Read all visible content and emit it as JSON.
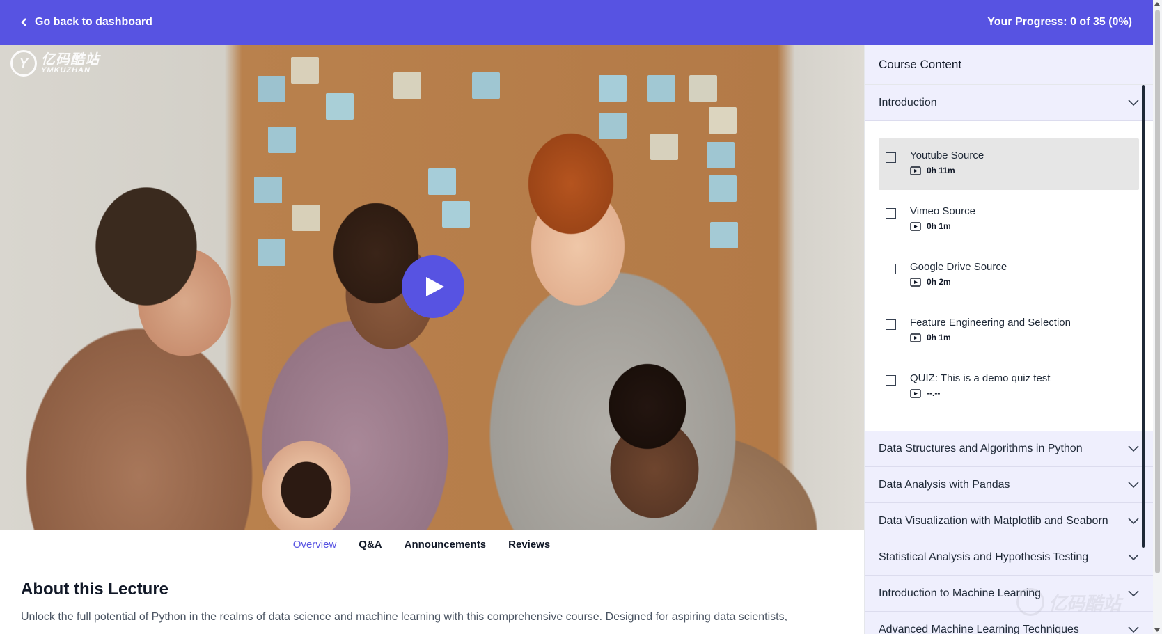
{
  "topbar": {
    "back_label": "Go back to dashboard",
    "progress_label": "Your Progress: 0 of 35 (0%)"
  },
  "video": {
    "logo_mark": "Y",
    "logo_zh": "亿码酷站",
    "logo_en": "YMKUZHAN"
  },
  "tabs": [
    {
      "label": "Overview",
      "active": true
    },
    {
      "label": "Q&A",
      "active": false
    },
    {
      "label": "Announcements",
      "active": false
    },
    {
      "label": "Reviews",
      "active": false
    }
  ],
  "about": {
    "heading": "About this Lecture",
    "text": "Unlock the full potential of Python in the realms of data science and machine learning with this comprehensive course. Designed for aspiring data scientists,"
  },
  "sidebar": {
    "title": "Course Content",
    "sections": [
      {
        "label": "Introduction",
        "expanded": true
      },
      {
        "label": "Data Structures and Algorithms in Python",
        "expanded": false
      },
      {
        "label": "Data Analysis with Pandas",
        "expanded": false
      },
      {
        "label": "Data Visualization with Matplotlib and Seaborn",
        "expanded": false
      },
      {
        "label": "Statistical Analysis and Hypothesis Testing",
        "expanded": false
      },
      {
        "label": "Introduction to Machine Learning",
        "expanded": false
      },
      {
        "label": "Advanced Machine Learning Techniques",
        "expanded": false
      }
    ],
    "lessons": [
      {
        "title": "Youtube Source",
        "duration": "0h 11m",
        "active": true
      },
      {
        "title": "Vimeo Source",
        "duration": "0h 1m",
        "active": false
      },
      {
        "title": "Google Drive Source",
        "duration": "0h 2m",
        "active": false
      },
      {
        "title": "Feature Engineering and Selection",
        "duration": "0h 1m",
        "active": false
      },
      {
        "title": "QUIZ: This is a demo quiz test",
        "duration": "--.--",
        "active": false
      }
    ]
  },
  "colors": {
    "accent": "#5753e2",
    "section_bg": "#efeffd",
    "active_lesson_bg": "#e6e6e6"
  },
  "icons": {
    "back": "chevron-left-icon",
    "play": "play-icon",
    "section_toggle": "chevron-down-icon",
    "lesson_type": "video-icon"
  }
}
